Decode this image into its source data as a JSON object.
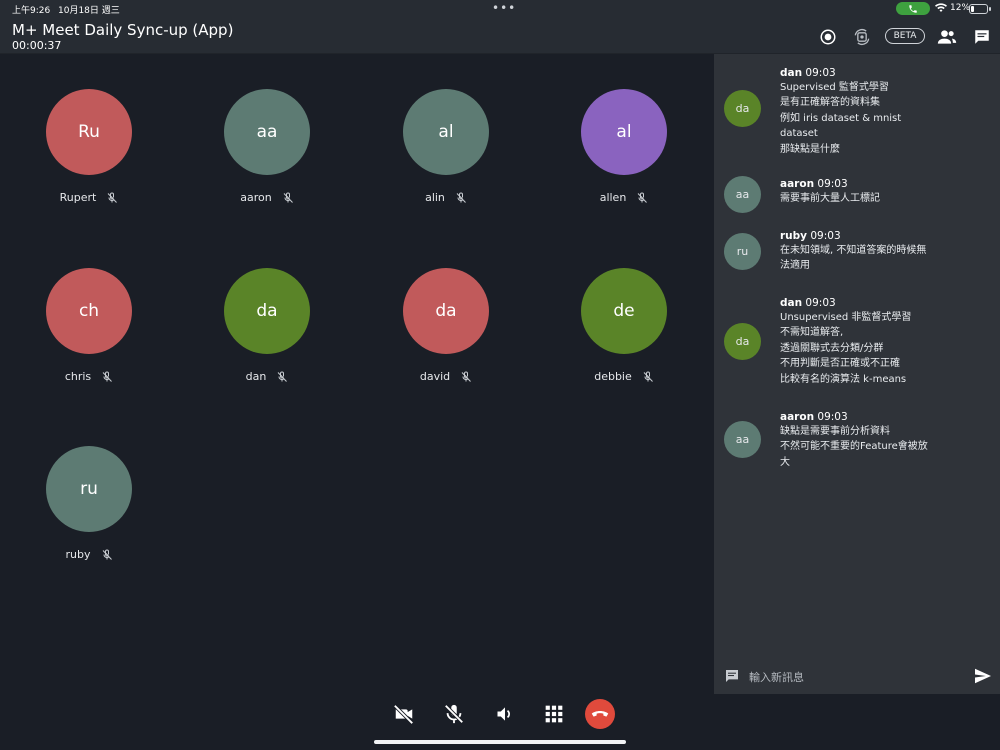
{
  "status_bar": {
    "time": "上午9:26",
    "date": "10月18日 週三",
    "battery": "12%",
    "icons": [
      "phone-icon",
      "wifi-icon",
      "battery-icon"
    ]
  },
  "header": {
    "title": "M+ Meet Daily Sync-up (App)",
    "timer": "00:00:37",
    "beta_label": "BETA",
    "icons": [
      "record-icon",
      "switch-camera-icon",
      "participants-icon",
      "chat-icon"
    ]
  },
  "participants": [
    {
      "initials": "Ru",
      "name": "Rupert",
      "color": "#c15a5b"
    },
    {
      "initials": "aa",
      "name": "aaron",
      "color": "#5d7b73"
    },
    {
      "initials": "al",
      "name": "alin",
      "color": "#5d7b73"
    },
    {
      "initials": "al",
      "name": "allen",
      "color": "#8a63bf"
    },
    {
      "initials": "ch",
      "name": "chris",
      "color": "#c15a5b"
    },
    {
      "initials": "da",
      "name": "dan",
      "color": "#5a8428"
    },
    {
      "initials": "da",
      "name": "david",
      "color": "#c15a5b"
    },
    {
      "initials": "de",
      "name": "debbie",
      "color": "#5a8428"
    },
    {
      "initials": "ru",
      "name": "ruby",
      "color": "#5d7b73"
    }
  ],
  "chat": {
    "messages": [
      {
        "initials": "da",
        "color": "#5a8428",
        "author": "dan",
        "time": "09:03",
        "lines": [
          "Supervised 監督式學習",
          "是有正確解答的資料集",
          "例如 iris dataset & mnist",
          "dataset",
          "那缺點是什麼"
        ]
      },
      {
        "initials": "aa",
        "color": "#5d7b73",
        "author": "aaron",
        "time": "09:03",
        "lines": [
          "需要事前大量人工標記"
        ]
      },
      {
        "initials": "ru",
        "color": "#5d7b73",
        "author": "ruby",
        "time": "09:03",
        "lines": [
          "在未知領域, 不知道答案的時候無",
          "法適用"
        ]
      },
      {
        "initials": "da",
        "color": "#5a8428",
        "author": "dan",
        "time": "09:03",
        "lines": [
          "Unsupervised 非監督式學習",
          "不需知道解答,",
          "透過關聯式去分類/分群",
          "不用判斷是否正確或不正確",
          "比較有名的演算法 k-means"
        ]
      },
      {
        "initials": "aa",
        "color": "#5d7b73",
        "author": "aaron",
        "time": "09:03",
        "lines": [
          "缺點是需要事前分析資料",
          "不然可能不重要的Feature會被放",
          "大"
        ]
      }
    ],
    "input_placeholder": "輸入新訊息"
  },
  "controls": [
    "camera-off-icon",
    "mic-off-icon",
    "speaker-icon",
    "grid-icon",
    "hangup-icon"
  ]
}
